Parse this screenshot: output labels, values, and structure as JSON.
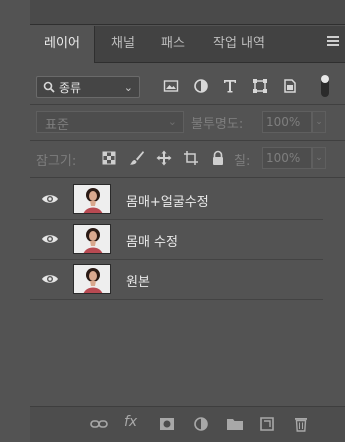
{
  "tabs": [
    {
      "label": "레이어",
      "active": true
    },
    {
      "label": "채널",
      "active": false
    },
    {
      "label": "패스",
      "active": false
    },
    {
      "label": "작업 내역",
      "active": false
    }
  ],
  "filter": {
    "selected": "종류"
  },
  "filter_icons": [
    "image-filter-icon",
    "adjustment-filter-icon",
    "type-filter-icon",
    "shape-filter-icon",
    "smart-object-filter-icon"
  ],
  "blend": {
    "mode": "표준",
    "opacity_label": "불투명도:",
    "opacity_value": "100%"
  },
  "lock": {
    "label": "잠그기:",
    "fill_label": "칠:",
    "fill_value": "100%"
  },
  "layers": [
    {
      "name": "몸매+얼굴수정",
      "visible": true
    },
    {
      "name": "몸매 수정",
      "visible": true
    },
    {
      "name": "원본",
      "visible": true
    }
  ],
  "colors": {
    "panel_bg": "#535353",
    "tabbar_bg": "#424242",
    "text": "#e9e9e9",
    "dim_text": "#7e7e7e"
  }
}
